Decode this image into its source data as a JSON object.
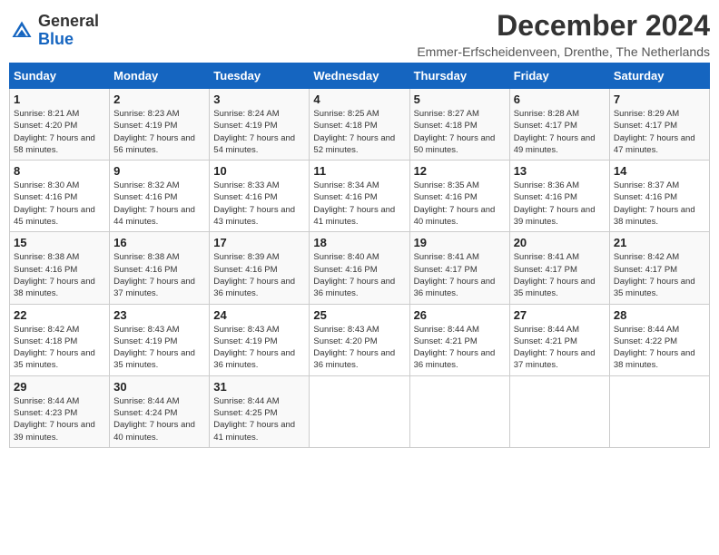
{
  "header": {
    "logo_general": "General",
    "logo_blue": "Blue",
    "month_title": "December 2024",
    "subtitle": "Emmer-Erfscheidenveen, Drenthe, The Netherlands"
  },
  "days_of_week": [
    "Sunday",
    "Monday",
    "Tuesday",
    "Wednesday",
    "Thursday",
    "Friday",
    "Saturday"
  ],
  "weeks": [
    [
      {
        "day": "1",
        "sunrise": "Sunrise: 8:21 AM",
        "sunset": "Sunset: 4:20 PM",
        "daylight": "Daylight: 7 hours and 58 minutes."
      },
      {
        "day": "2",
        "sunrise": "Sunrise: 8:23 AM",
        "sunset": "Sunset: 4:19 PM",
        "daylight": "Daylight: 7 hours and 56 minutes."
      },
      {
        "day": "3",
        "sunrise": "Sunrise: 8:24 AM",
        "sunset": "Sunset: 4:19 PM",
        "daylight": "Daylight: 7 hours and 54 minutes."
      },
      {
        "day": "4",
        "sunrise": "Sunrise: 8:25 AM",
        "sunset": "Sunset: 4:18 PM",
        "daylight": "Daylight: 7 hours and 52 minutes."
      },
      {
        "day": "5",
        "sunrise": "Sunrise: 8:27 AM",
        "sunset": "Sunset: 4:18 PM",
        "daylight": "Daylight: 7 hours and 50 minutes."
      },
      {
        "day": "6",
        "sunrise": "Sunrise: 8:28 AM",
        "sunset": "Sunset: 4:17 PM",
        "daylight": "Daylight: 7 hours and 49 minutes."
      },
      {
        "day": "7",
        "sunrise": "Sunrise: 8:29 AM",
        "sunset": "Sunset: 4:17 PM",
        "daylight": "Daylight: 7 hours and 47 minutes."
      }
    ],
    [
      {
        "day": "8",
        "sunrise": "Sunrise: 8:30 AM",
        "sunset": "Sunset: 4:16 PM",
        "daylight": "Daylight: 7 hours and 45 minutes."
      },
      {
        "day": "9",
        "sunrise": "Sunrise: 8:32 AM",
        "sunset": "Sunset: 4:16 PM",
        "daylight": "Daylight: 7 hours and 44 minutes."
      },
      {
        "day": "10",
        "sunrise": "Sunrise: 8:33 AM",
        "sunset": "Sunset: 4:16 PM",
        "daylight": "Daylight: 7 hours and 43 minutes."
      },
      {
        "day": "11",
        "sunrise": "Sunrise: 8:34 AM",
        "sunset": "Sunset: 4:16 PM",
        "daylight": "Daylight: 7 hours and 41 minutes."
      },
      {
        "day": "12",
        "sunrise": "Sunrise: 8:35 AM",
        "sunset": "Sunset: 4:16 PM",
        "daylight": "Daylight: 7 hours and 40 minutes."
      },
      {
        "day": "13",
        "sunrise": "Sunrise: 8:36 AM",
        "sunset": "Sunset: 4:16 PM",
        "daylight": "Daylight: 7 hours and 39 minutes."
      },
      {
        "day": "14",
        "sunrise": "Sunrise: 8:37 AM",
        "sunset": "Sunset: 4:16 PM",
        "daylight": "Daylight: 7 hours and 38 minutes."
      }
    ],
    [
      {
        "day": "15",
        "sunrise": "Sunrise: 8:38 AM",
        "sunset": "Sunset: 4:16 PM",
        "daylight": "Daylight: 7 hours and 38 minutes."
      },
      {
        "day": "16",
        "sunrise": "Sunrise: 8:38 AM",
        "sunset": "Sunset: 4:16 PM",
        "daylight": "Daylight: 7 hours and 37 minutes."
      },
      {
        "day": "17",
        "sunrise": "Sunrise: 8:39 AM",
        "sunset": "Sunset: 4:16 PM",
        "daylight": "Daylight: 7 hours and 36 minutes."
      },
      {
        "day": "18",
        "sunrise": "Sunrise: 8:40 AM",
        "sunset": "Sunset: 4:16 PM",
        "daylight": "Daylight: 7 hours and 36 minutes."
      },
      {
        "day": "19",
        "sunrise": "Sunrise: 8:41 AM",
        "sunset": "Sunset: 4:17 PM",
        "daylight": "Daylight: 7 hours and 36 minutes."
      },
      {
        "day": "20",
        "sunrise": "Sunrise: 8:41 AM",
        "sunset": "Sunset: 4:17 PM",
        "daylight": "Daylight: 7 hours and 35 minutes."
      },
      {
        "day": "21",
        "sunrise": "Sunrise: 8:42 AM",
        "sunset": "Sunset: 4:17 PM",
        "daylight": "Daylight: 7 hours and 35 minutes."
      }
    ],
    [
      {
        "day": "22",
        "sunrise": "Sunrise: 8:42 AM",
        "sunset": "Sunset: 4:18 PM",
        "daylight": "Daylight: 7 hours and 35 minutes."
      },
      {
        "day": "23",
        "sunrise": "Sunrise: 8:43 AM",
        "sunset": "Sunset: 4:19 PM",
        "daylight": "Daylight: 7 hours and 35 minutes."
      },
      {
        "day": "24",
        "sunrise": "Sunrise: 8:43 AM",
        "sunset": "Sunset: 4:19 PM",
        "daylight": "Daylight: 7 hours and 36 minutes."
      },
      {
        "day": "25",
        "sunrise": "Sunrise: 8:43 AM",
        "sunset": "Sunset: 4:20 PM",
        "daylight": "Daylight: 7 hours and 36 minutes."
      },
      {
        "day": "26",
        "sunrise": "Sunrise: 8:44 AM",
        "sunset": "Sunset: 4:21 PM",
        "daylight": "Daylight: 7 hours and 36 minutes."
      },
      {
        "day": "27",
        "sunrise": "Sunrise: 8:44 AM",
        "sunset": "Sunset: 4:21 PM",
        "daylight": "Daylight: 7 hours and 37 minutes."
      },
      {
        "day": "28",
        "sunrise": "Sunrise: 8:44 AM",
        "sunset": "Sunset: 4:22 PM",
        "daylight": "Daylight: 7 hours and 38 minutes."
      }
    ],
    [
      {
        "day": "29",
        "sunrise": "Sunrise: 8:44 AM",
        "sunset": "Sunset: 4:23 PM",
        "daylight": "Daylight: 7 hours and 39 minutes."
      },
      {
        "day": "30",
        "sunrise": "Sunrise: 8:44 AM",
        "sunset": "Sunset: 4:24 PM",
        "daylight": "Daylight: 7 hours and 40 minutes."
      },
      {
        "day": "31",
        "sunrise": "Sunrise: 8:44 AM",
        "sunset": "Sunset: 4:25 PM",
        "daylight": "Daylight: 7 hours and 41 minutes."
      },
      null,
      null,
      null,
      null
    ]
  ]
}
